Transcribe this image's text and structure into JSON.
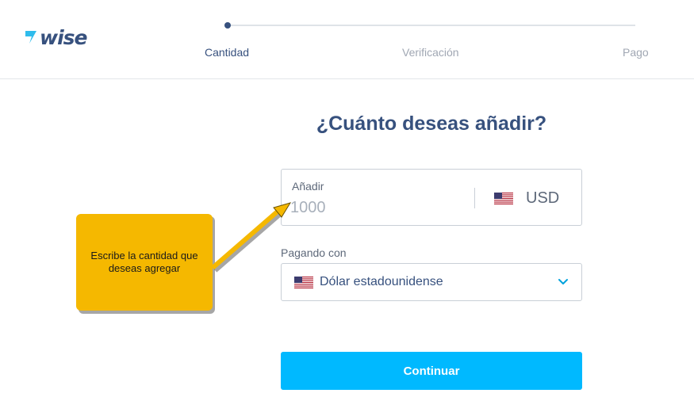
{
  "brand": {
    "name": "wise",
    "logo_color": "#37517e"
  },
  "stepper": {
    "steps": [
      {
        "label": "Cantidad",
        "state": "active"
      },
      {
        "label": "Verificación",
        "state": "pending"
      },
      {
        "label": "Pago",
        "state": "pending"
      }
    ]
  },
  "main": {
    "title": "¿Cuánto deseas añadir?",
    "amount": {
      "label": "Añadir",
      "value": "",
      "placeholder": "1000",
      "currency": "USD",
      "currency_flag": "us-flag-icon"
    },
    "paying": {
      "label": "Pagando con",
      "selected": "Dólar estadounidense",
      "flag": "us-flag-icon"
    },
    "continue_label": "Continuar"
  },
  "annotation": {
    "text": "Escribe la cantidad que deseas agregar",
    "color": "#f5b800"
  },
  "colors": {
    "primary": "#37517e",
    "accent": "#00b9ff",
    "muted": "#a0a7b3"
  }
}
